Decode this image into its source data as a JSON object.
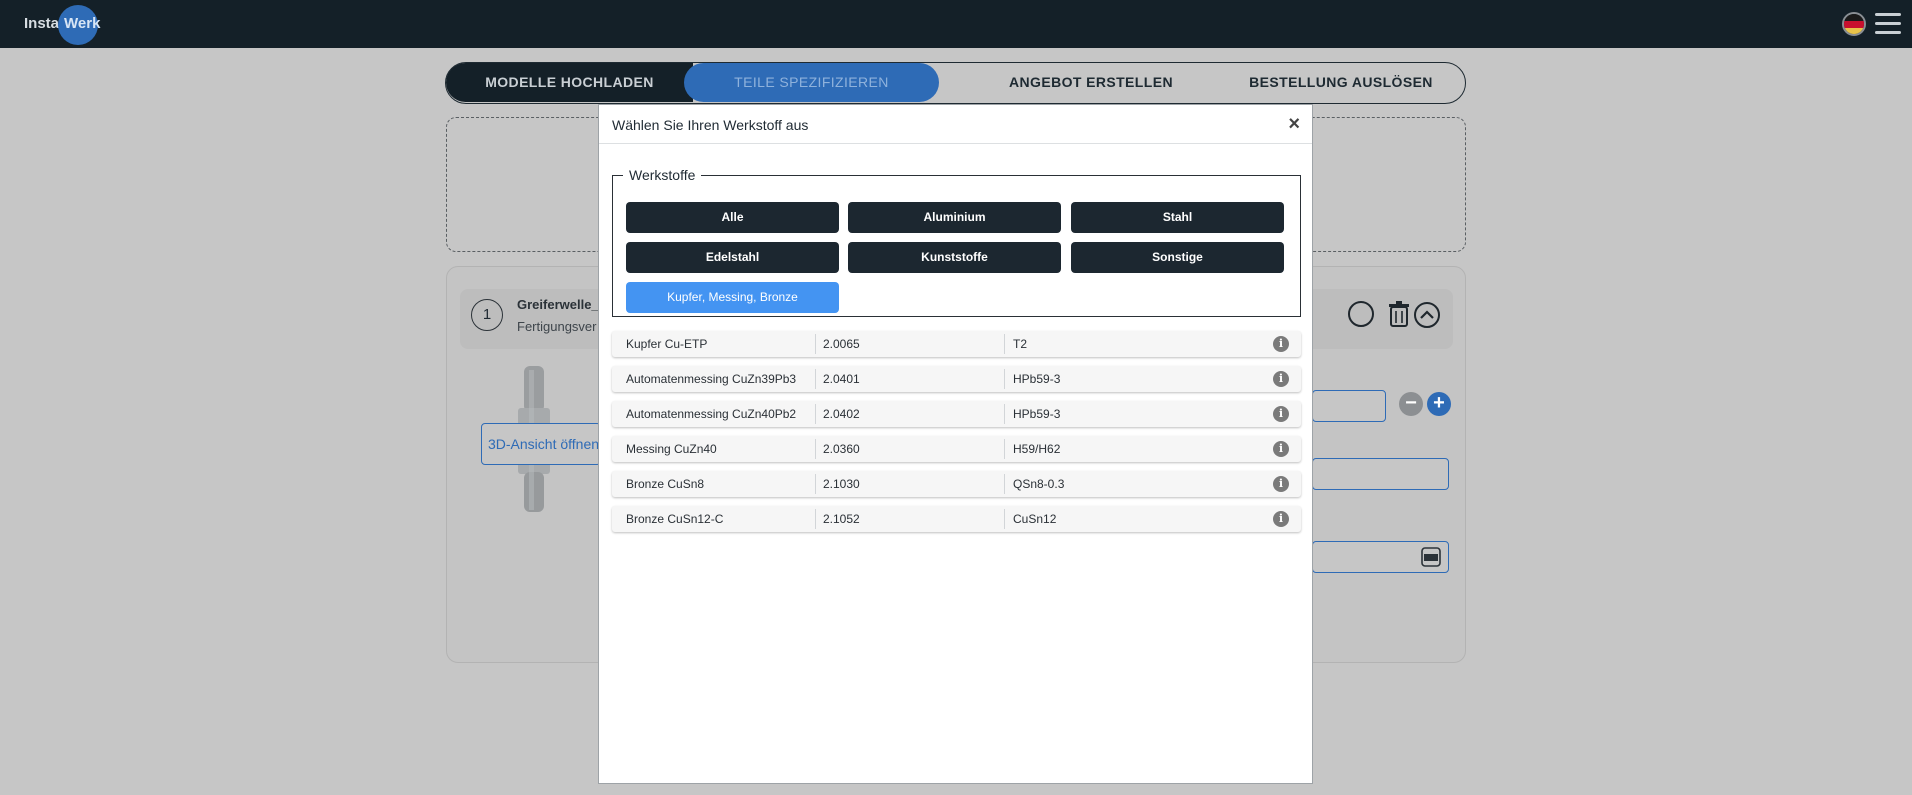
{
  "app": {
    "logo_left": "Insta",
    "logo_right": "Werk"
  },
  "steps": [
    {
      "label": "MODELLE HOCHLADEN",
      "state": "done"
    },
    {
      "label": "TEILE SPEZIFIZIEREN",
      "state": "active"
    },
    {
      "label": "ANGEBOT ERSTELLEN",
      "state": "pending"
    },
    {
      "label": "BESTELLUNG AUSLÖSEN",
      "state": "pending"
    }
  ],
  "part": {
    "number": "1",
    "name": "Greiferwelle_",
    "subtitle": "Fertigungsver",
    "view3d_label": "3D-Ansicht öffnen"
  },
  "modal": {
    "title": "Wählen Sie Ihren Werkstoff aus",
    "close_label": "×",
    "legend": "Werkstoffe",
    "categories": [
      "Alle",
      "Aluminium",
      "Stahl",
      "Edelstahl",
      "Kunststoffe",
      "Sonstige",
      "Kupfer, Messing, Bronze"
    ],
    "selected_category": "Kupfer, Messing, Bronze",
    "materials": [
      {
        "name": "Kupfer Cu-ETP",
        "number": "2.0065",
        "designation": "T2"
      },
      {
        "name": "Automatenmessing CuZn39Pb3",
        "number": "2.0401",
        "designation": "HPb59-3"
      },
      {
        "name": "Automatenmessing CuZn40Pb2",
        "number": "2.0402",
        "designation": "HPb59-3"
      },
      {
        "name": "Messing CuZn40",
        "number": "2.0360",
        "designation": "H59/H62"
      },
      {
        "name": "Bronze CuSn8",
        "number": "2.1030",
        "designation": "QSn8-0.3"
      },
      {
        "name": "Bronze CuSn12-C",
        "number": "2.1052",
        "designation": "CuSn12"
      }
    ]
  },
  "colors": {
    "topbar": "#142028",
    "accent_blue": "#2e6bb6",
    "selected_category": "#4494f2",
    "category_button": "#1c2730"
  },
  "icons": {
    "info": "info-icon",
    "close": "close-icon",
    "menu": "hamburger-menu-icon",
    "language": "german-flag-icon",
    "delete": "trash-icon",
    "collapse": "chevron-up-icon",
    "decrease": "minus-circle-icon",
    "pdf": "pdf-icon"
  }
}
